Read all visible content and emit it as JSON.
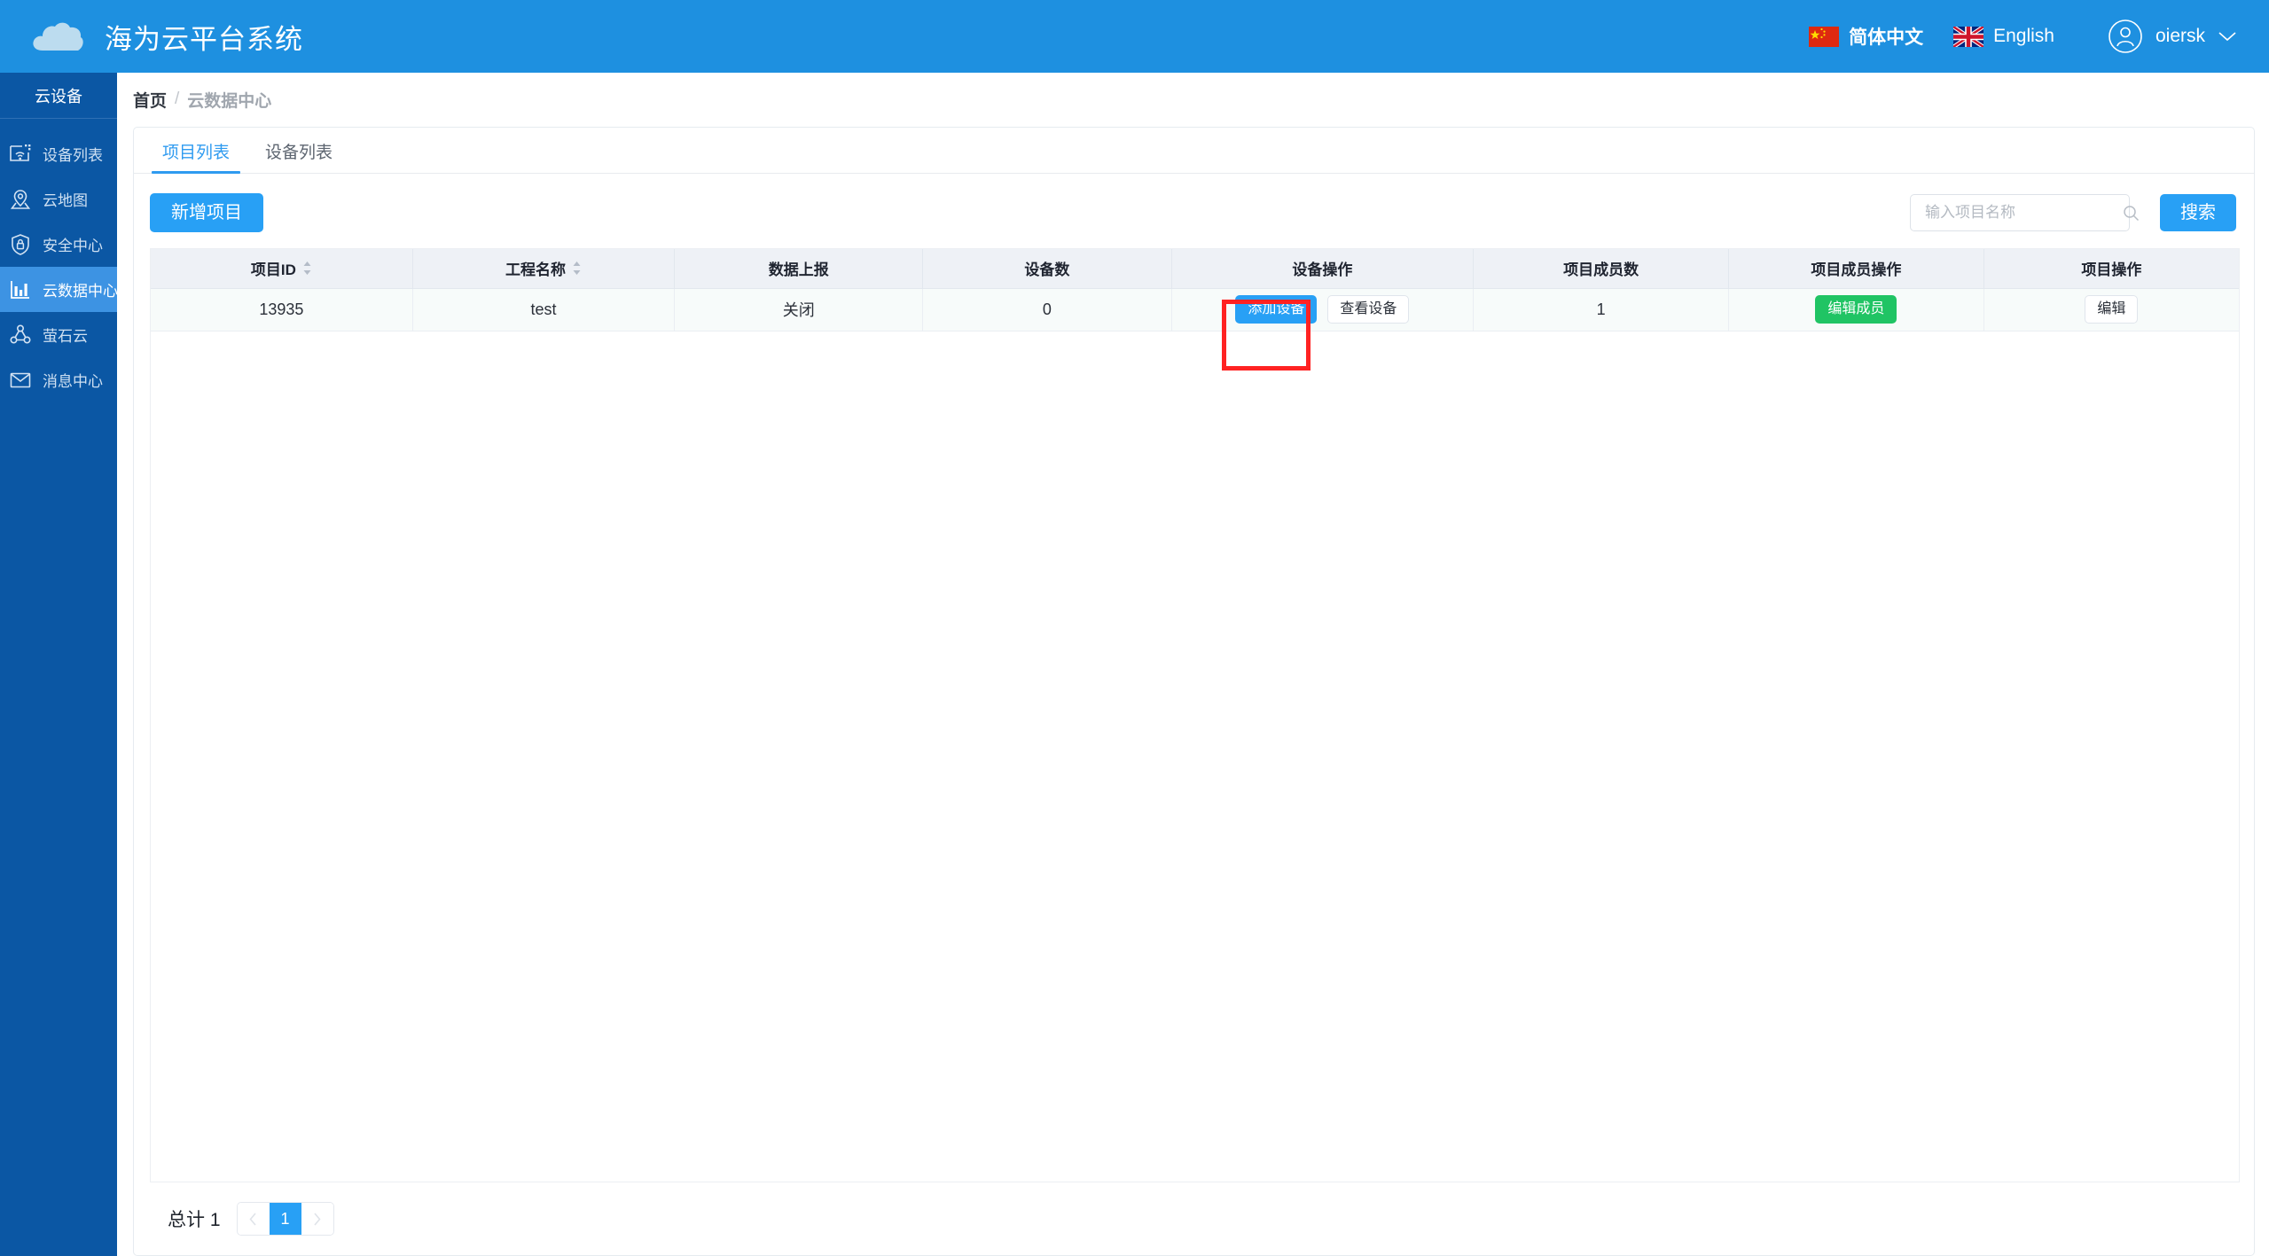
{
  "header": {
    "brand_title": "海为云平台系统",
    "logo_icon": "cloud-icon",
    "languages": [
      {
        "label": "简体中文",
        "icon": "china-flag-icon",
        "active": true
      },
      {
        "label": "English",
        "icon": "uk-flag-icon",
        "active": false
      }
    ],
    "user": {
      "name": "oiersk",
      "avatar_icon": "user-circle-icon",
      "caret_icon": "chevron-down-icon"
    }
  },
  "sidebar": {
    "title": "云设备",
    "items": [
      {
        "label": "设备列表",
        "icon": "device-wifi-icon",
        "active": false
      },
      {
        "label": "云地图",
        "icon": "map-pin-icon",
        "active": false
      },
      {
        "label": "安全中心",
        "icon": "shield-lock-icon",
        "active": false
      },
      {
        "label": "云数据中心",
        "icon": "bar-chart-icon",
        "active": true
      },
      {
        "label": "萤石云",
        "icon": "nodes-icon",
        "active": false
      },
      {
        "label": "消息中心",
        "icon": "envelope-icon",
        "active": false
      }
    ]
  },
  "breadcrumb": {
    "home": "首页",
    "separator": "/",
    "current": "云数据中心"
  },
  "tabs": [
    {
      "label": "项目列表",
      "active": true
    },
    {
      "label": "设备列表",
      "active": false
    }
  ],
  "toolbar": {
    "new_project_label": "新增项目",
    "search_placeholder": "输入项目名称",
    "search_value": "",
    "search_icon": "search-icon",
    "search_button_label": "搜索"
  },
  "table": {
    "columns": [
      {
        "label": "项目ID",
        "sortable": true
      },
      {
        "label": "工程名称",
        "sortable": true
      },
      {
        "label": "数据上报",
        "sortable": false
      },
      {
        "label": "设备数",
        "sortable": false
      },
      {
        "label": "设备操作",
        "sortable": false
      },
      {
        "label": "项目成员数",
        "sortable": false
      },
      {
        "label": "项目成员操作",
        "sortable": false
      },
      {
        "label": "项目操作",
        "sortable": false
      }
    ],
    "rows": [
      {
        "project_id": "13935",
        "project_name": "test",
        "data_report": "关闭",
        "device_count": "0",
        "device_actions": [
          {
            "label": "添加设备",
            "style": "primary"
          },
          {
            "label": "查看设备",
            "style": "ghost"
          }
        ],
        "member_count": "1",
        "member_actions": [
          {
            "label": "编辑成员",
            "style": "success"
          }
        ],
        "project_actions": [
          {
            "label": "编辑",
            "style": "ghost"
          }
        ]
      }
    ]
  },
  "pagination": {
    "total_label": "总计 1",
    "prev_icon": "chevron-left-icon",
    "next_icon": "chevron-right-icon",
    "pages": [
      "1"
    ],
    "current_page": "1"
  },
  "annotation": {
    "highlight_color": "#ff2222",
    "target": "添加设备"
  },
  "colors": {
    "header_blue": "#1e90e0",
    "sidebar_blue": "#0b57a4",
    "sidebar_active": "#3d93e3",
    "accent": "#28a0f5",
    "success": "#20c464",
    "table_header_bg": "#eef1f6"
  }
}
